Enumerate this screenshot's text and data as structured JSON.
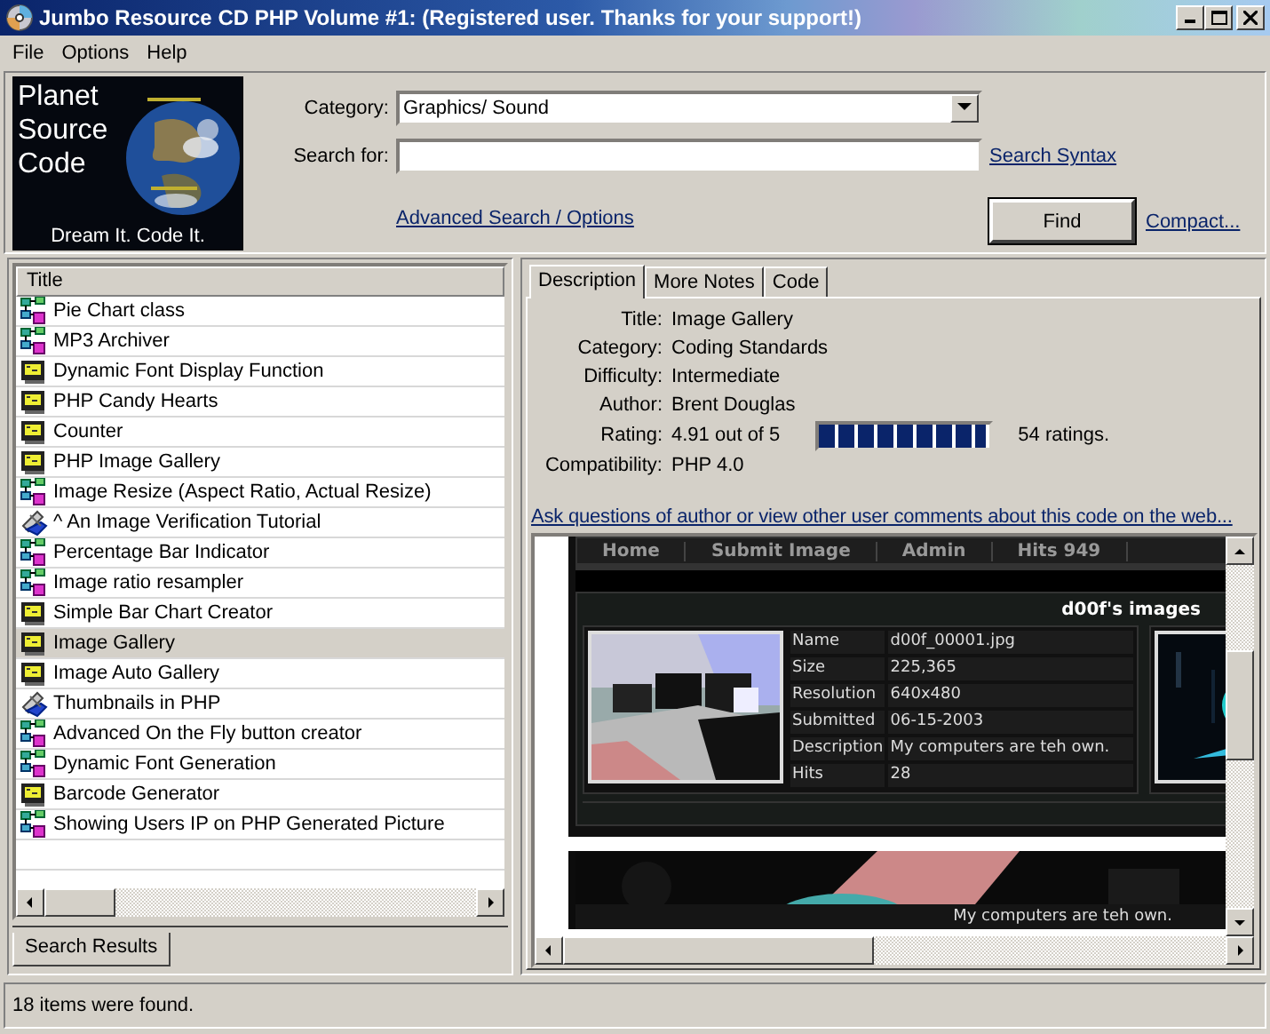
{
  "window": {
    "title": "Jumbo Resource CD PHP Volume #1: (Registered user.  Thanks for your support!)"
  },
  "menu": [
    "File",
    "Options",
    "Help"
  ],
  "logo": {
    "lines": [
      "Planet",
      "Source",
      "Code"
    ],
    "tagline": "Dream It.  Code It."
  },
  "search": {
    "category_label": "Category:",
    "category": "Graphics/ Sound",
    "search_label": "Search for:",
    "search_syntax": "Search Syntax",
    "advanced": "Advanced Search / Options",
    "find": "Find",
    "compact": "Compact..."
  },
  "results": {
    "column": "Title",
    "tab": "Search Results",
    "items": [
      {
        "title": "Pie Chart class",
        "kind": "diagram",
        "selected": false
      },
      {
        "title": "MP3 Archiver",
        "kind": "diagram",
        "selected": false
      },
      {
        "title": "Dynamic Font Display Function",
        "kind": "window",
        "selected": false
      },
      {
        "title": "PHP Candy Hearts",
        "kind": "window",
        "selected": false
      },
      {
        "title": "Counter",
        "kind": "window",
        "selected": false
      },
      {
        "title": "PHP Image Gallery",
        "kind": "window",
        "selected": false
      },
      {
        "title": "Image Resize (Aspect Ratio, Actual Resize)",
        "kind": "diagram",
        "selected": false
      },
      {
        "title": "^ An  Image Verification Tutorial",
        "kind": "tool",
        "selected": false
      },
      {
        "title": "Percentage Bar Indicator",
        "kind": "diagram",
        "selected": false
      },
      {
        "title": "Image ratio resampler",
        "kind": "diagram",
        "selected": false
      },
      {
        "title": "Simple Bar Chart Creator",
        "kind": "window",
        "selected": false
      },
      {
        "title": "Image Gallery",
        "kind": "window",
        "selected": true
      },
      {
        "title": "Image Auto Gallery",
        "kind": "window",
        "selected": false
      },
      {
        "title": "Thumbnails in PHP",
        "kind": "tool",
        "selected": false
      },
      {
        "title": "Advanced On the Fly button creator",
        "kind": "diagram",
        "selected": false
      },
      {
        "title": "Dynamic Font Generation",
        "kind": "diagram",
        "selected": false
      },
      {
        "title": "Barcode Generator",
        "kind": "window",
        "selected": false
      },
      {
        "title": "Showing Users IP on PHP Generated Picture",
        "kind": "diagram",
        "selected": false
      }
    ]
  },
  "details": {
    "tabs": [
      {
        "label": "Description",
        "selected": true
      },
      {
        "label": "More Notes",
        "selected": false
      },
      {
        "label": "Code",
        "selected": false
      }
    ],
    "fields": [
      {
        "label": "Title:",
        "value": "Image Gallery",
        "kind": "text"
      },
      {
        "label": "Category:",
        "value": "Coding Standards",
        "kind": "text"
      },
      {
        "label": "Difficulty:",
        "value": "Intermediate",
        "kind": "text"
      },
      {
        "label": "Author:",
        "value": "Brent  Douglas",
        "kind": "text"
      },
      {
        "label": "Rating:",
        "value": "4.91 out of 5",
        "kind": "rating",
        "level": 0.982,
        "count": "54 ratings."
      },
      {
        "label": "Compatibility:",
        "value": "PHP 4.0",
        "kind": "text"
      }
    ],
    "link": "Ask questions of author or view other user comments about this code on the web..."
  },
  "preview": {
    "nav": [
      "Home",
      "Submit Image",
      "Admin",
      "Hits 949"
    ],
    "heading": "d00f's images",
    "info": [
      {
        "label": "Name",
        "value": "d00f_00001.jpg"
      },
      {
        "label": "Size",
        "value": "225,365"
      },
      {
        "label": "Resolution",
        "value": "640x480"
      },
      {
        "label": "Submitted",
        "value": "06-15-2003"
      },
      {
        "label": "Description",
        "value": "My computers are teh own."
      },
      {
        "label": "Hits",
        "value": "28"
      }
    ],
    "caption": "My computers are teh own."
  },
  "status_bar": "18 items were found."
}
